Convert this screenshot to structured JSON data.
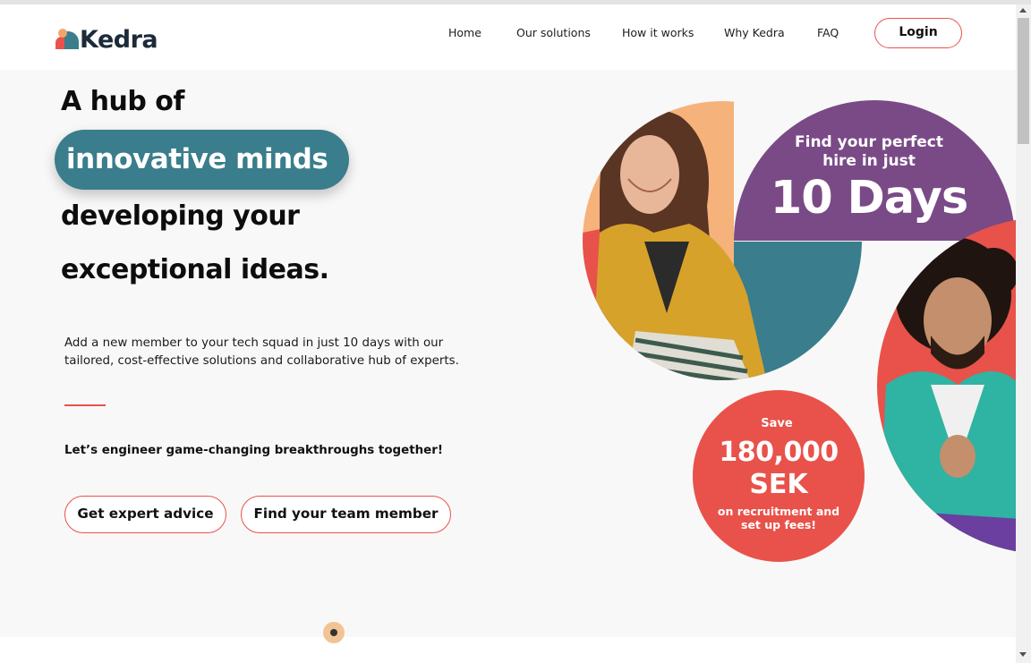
{
  "brand": {
    "name": "Kedra",
    "colors": {
      "red": "#e8524a",
      "teal": "#3a7d8c",
      "purple": "#7a4a87",
      "peach": "#f2a56b"
    }
  },
  "nav": {
    "items": [
      "Home",
      "Our solutions",
      "How it works",
      "Why Kedra",
      "FAQ"
    ],
    "login_label": "Login"
  },
  "hero": {
    "line1": "A hub of",
    "highlight": "innovative minds",
    "line3": "developing your",
    "line4": "exceptional ideas.",
    "description": "Add a new member to your tech squad in just 10 days with our tailored, cost-effective solutions and collaborative hub of experts.",
    "tagline": "Let’s engineer game-changing breakthroughs together!",
    "buttons": {
      "advice": "Get expert advice",
      "team": "Find your team member"
    }
  },
  "badges": {
    "hire": {
      "lead": "Find your perfect hire in just",
      "value": "10 Days"
    },
    "save": {
      "lead": "Save",
      "amount": "180,000",
      "unit": "SEK",
      "note": "on recruitment and set up fees!"
    }
  },
  "icons": {
    "scroll_indicator": "scroll-down-dot-icon",
    "logo_mark": "kedra-logo-icon"
  }
}
